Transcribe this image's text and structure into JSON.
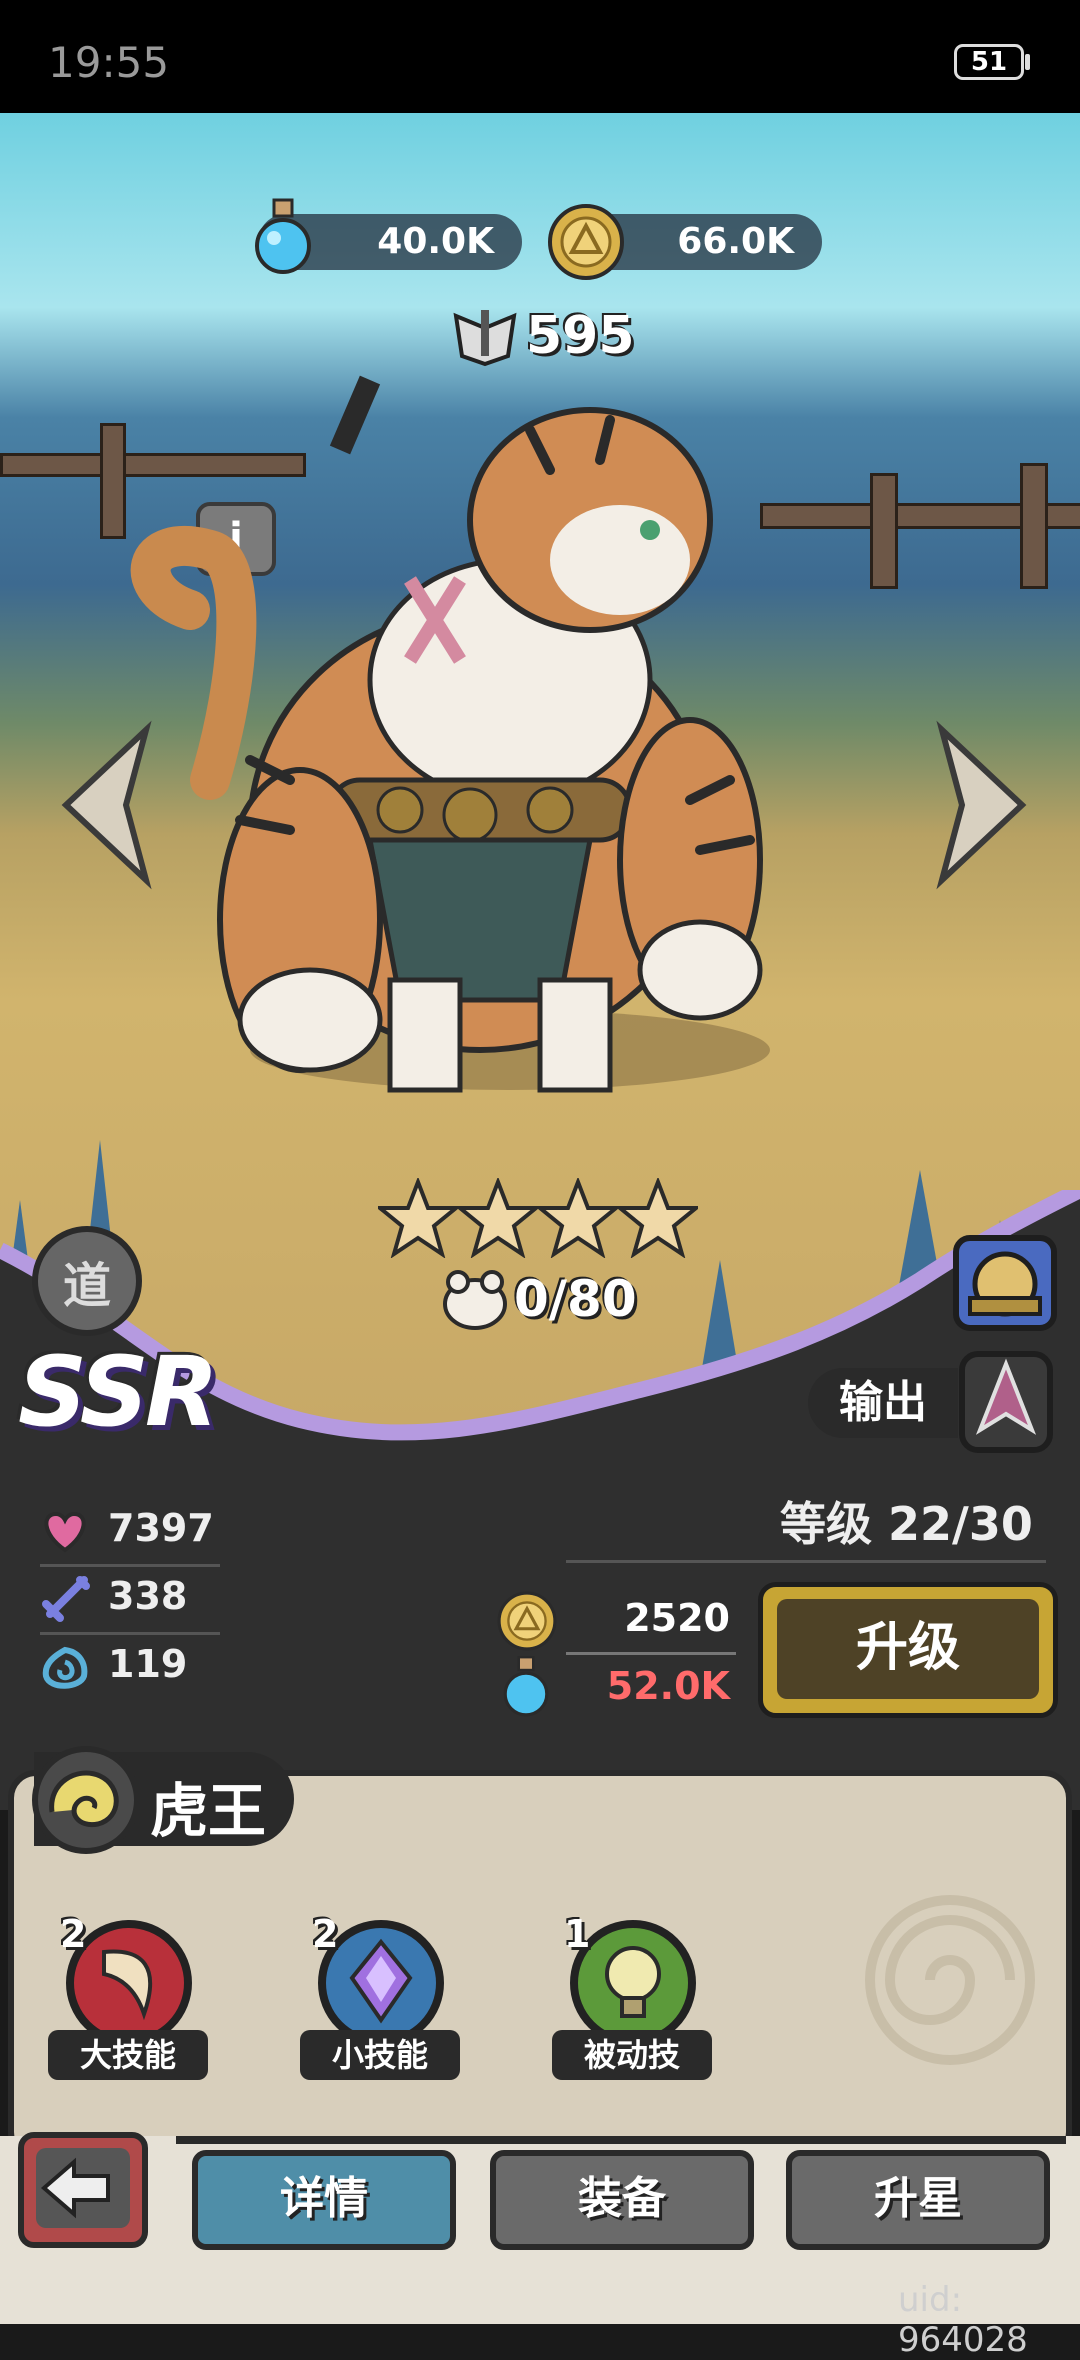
{
  "status_bar": {
    "time": "19:55",
    "battery": "51"
  },
  "resources": {
    "potion_amount": "40.0K",
    "gold_amount": "66.0K"
  },
  "hero": {
    "power": "595",
    "stars": 4,
    "shards": "0/80",
    "rarity": "SSR",
    "faction_badge": "道",
    "role": "输出",
    "level_text": "等级 22/30",
    "name": "虎王"
  },
  "stats": {
    "hp": "7397",
    "attack": "338",
    "defense": "119"
  },
  "upgrade": {
    "gold_cost": "2520",
    "potion_cost": "52.0K",
    "button_label": "升级"
  },
  "skills": [
    {
      "label": "大技能",
      "level": "2",
      "icon": "horn-icon",
      "color": "#b8303a"
    },
    {
      "label": "小技能",
      "level": "2",
      "icon": "crystal-icon",
      "color": "#3a78b0"
    },
    {
      "label": "被动技",
      "level": "1",
      "icon": "lightbulb-icon",
      "color": "#5c9a3a"
    }
  ],
  "tabs": {
    "details": "详情",
    "equipment": "装备",
    "star_up": "升星"
  },
  "uid": "uid: 964028"
}
